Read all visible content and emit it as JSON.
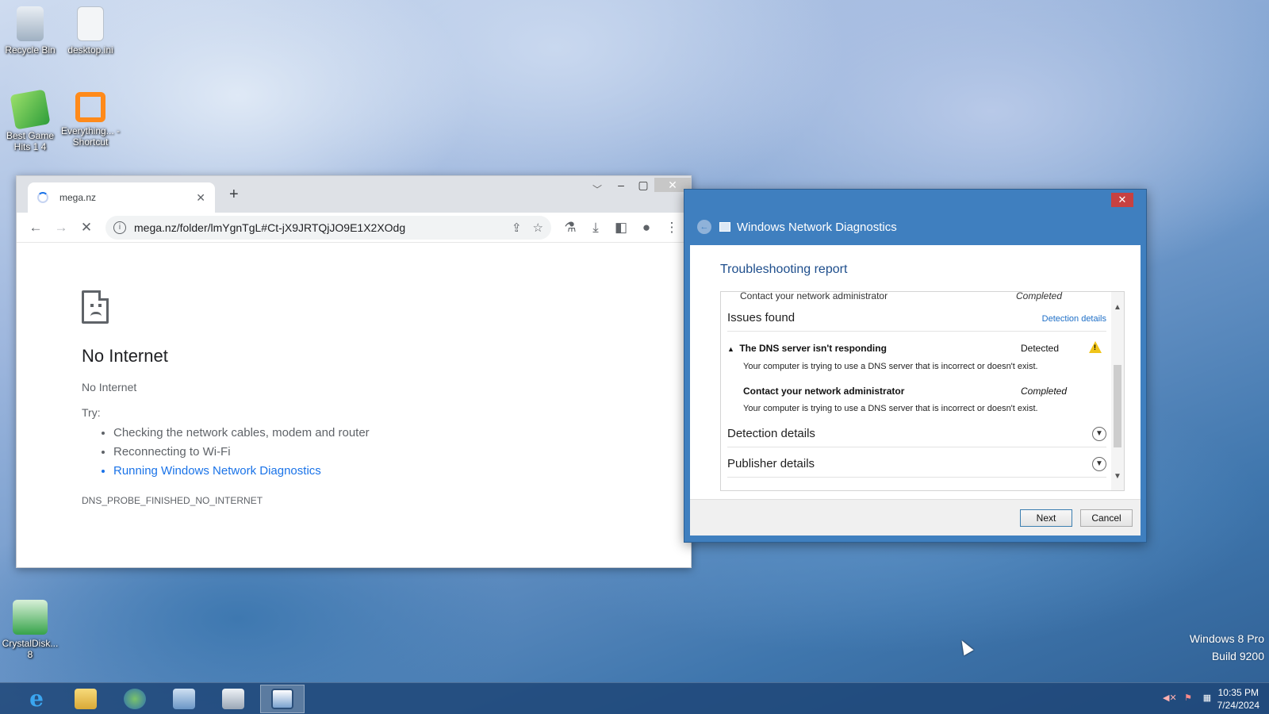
{
  "desktop": {
    "icons": [
      {
        "label": "Recycle Bin",
        "icon": "recycle-bin-icon"
      },
      {
        "label": "desktop.ini",
        "icon": "ini-file-icon"
      },
      {
        "label": "Best Game Hits 1 4",
        "icon": "game-dice-icon"
      },
      {
        "label": "Everything... - Shortcut",
        "icon": "everything-search-icon"
      },
      {
        "label": "CrystalDisk... 8",
        "icon": "crystaldisk-icon"
      }
    ],
    "watermark_line1": "Windows 8 Pro",
    "watermark_line2": "Build 9200"
  },
  "browser": {
    "tab_title": "mega.nz",
    "tab_close": "✕",
    "new_tab": "+",
    "url": "mega.nz/folder/lmYgnTgL#Ct-jX9JRTQjJO9E1X2XOdg",
    "error": {
      "title": "No Internet",
      "subtitle": "No Internet",
      "try_label": "Try:",
      "suggestions": [
        "Checking the network cables, modem and router",
        "Reconnecting to Wi-Fi",
        "Running Windows Network Diagnostics"
      ],
      "code": "DNS_PROBE_FINISHED_NO_INTERNET"
    }
  },
  "diagnostics": {
    "window_title": "Windows Network Diagnostics",
    "report_title": "Troubleshooting report",
    "cut_row": {
      "label": "Contact your network administrator",
      "status": "Completed"
    },
    "issues_found_label": "Issues found",
    "detection_details_link": "Detection details",
    "issues": [
      {
        "title": "The DNS server isn't responding",
        "status": "Detected",
        "description": "Your computer is trying to use a DNS server that is incorrect or doesn't exist."
      },
      {
        "title": "Contact your network administrator",
        "status": "Completed",
        "description": "Your computer is trying to use a DNS server that is incorrect or doesn't exist."
      }
    ],
    "detection_details_section": "Detection details",
    "publisher_details_section": "Publisher details",
    "next_label": "Next",
    "cancel_label": "Cancel",
    "close_glyph": "✕"
  },
  "taskbar": {
    "apps": [
      "internet-explorer-icon",
      "file-explorer-icon",
      "network-icon",
      "control-panel-icon",
      "keyboard-icon",
      "network-diagnostics-icon"
    ],
    "time": "10:35 PM",
    "date": "7/24/2024"
  }
}
